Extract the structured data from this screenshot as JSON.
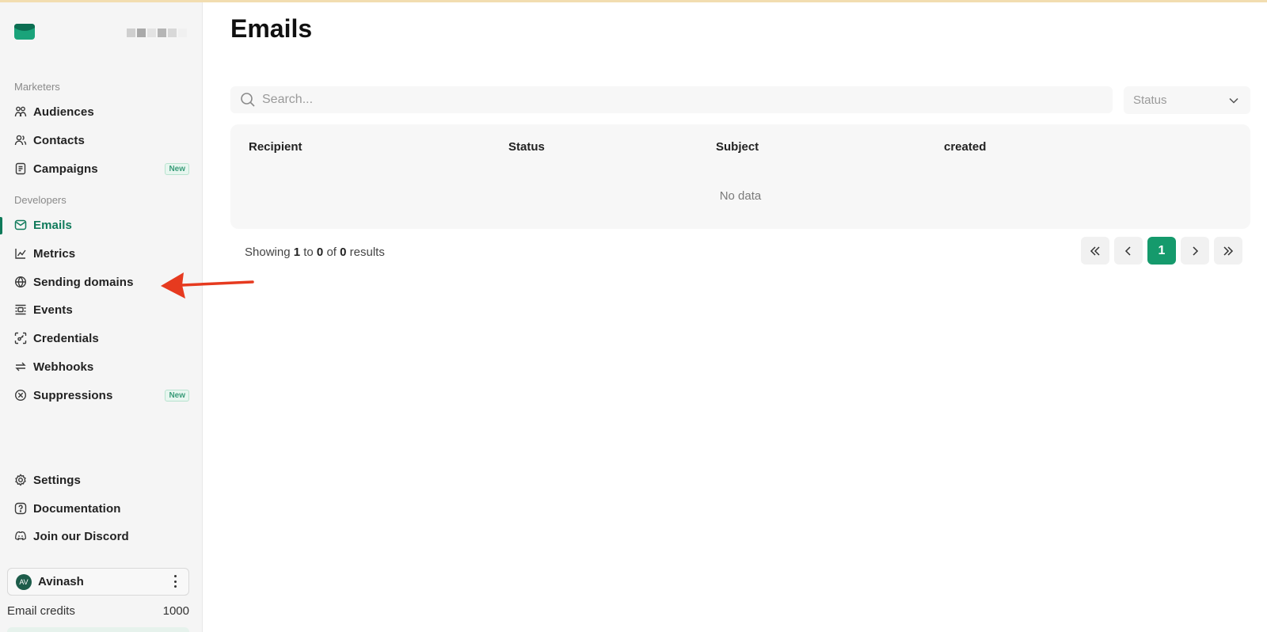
{
  "colors": {
    "accent": "#0f7a5a",
    "accent_button": "#159a6c",
    "annotation_arrow": "#e63a1f",
    "sidebar_bg": "#f5f5f5"
  },
  "sidebar": {
    "sections": [
      {
        "label": "Marketers",
        "items": [
          {
            "label": "Audiences",
            "icon": "audiences-icon"
          },
          {
            "label": "Contacts",
            "icon": "contacts-icon"
          },
          {
            "label": "Campaigns",
            "icon": "campaigns-icon",
            "badge": "New"
          }
        ]
      },
      {
        "label": "Developers",
        "items": [
          {
            "label": "Emails",
            "icon": "mail-icon",
            "active": true
          },
          {
            "label": "Metrics",
            "icon": "chart-icon"
          },
          {
            "label": "Sending domains",
            "icon": "globe-icon"
          },
          {
            "label": "Events",
            "icon": "events-icon"
          },
          {
            "label": "Credentials",
            "icon": "key-icon"
          },
          {
            "label": "Webhooks",
            "icon": "webhook-icon"
          },
          {
            "label": "Suppressions",
            "icon": "block-icon",
            "badge": "New"
          }
        ]
      }
    ],
    "bottom_items": [
      {
        "label": "Settings",
        "icon": "gear-icon"
      },
      {
        "label": "Documentation",
        "icon": "help-icon"
      },
      {
        "label": "Join our Discord",
        "icon": "discord-icon"
      }
    ],
    "user": {
      "initials": "AV",
      "name": "Avinash"
    },
    "credits": {
      "label": "Email credits",
      "value": "1000"
    }
  },
  "main": {
    "title": "Emails",
    "search": {
      "placeholder": "Search...",
      "value": ""
    },
    "status_filter": {
      "placeholder": "Status"
    },
    "table": {
      "columns": [
        "Recipient",
        "Status",
        "Subject",
        "created"
      ],
      "rows": [],
      "empty_text": "No data"
    },
    "results": {
      "prefix": "Showing",
      "from": "1",
      "to_word": "to",
      "to": "0",
      "of_word": "of",
      "total": "0",
      "suffix": "results"
    },
    "pagination": {
      "current_page": "1"
    }
  }
}
